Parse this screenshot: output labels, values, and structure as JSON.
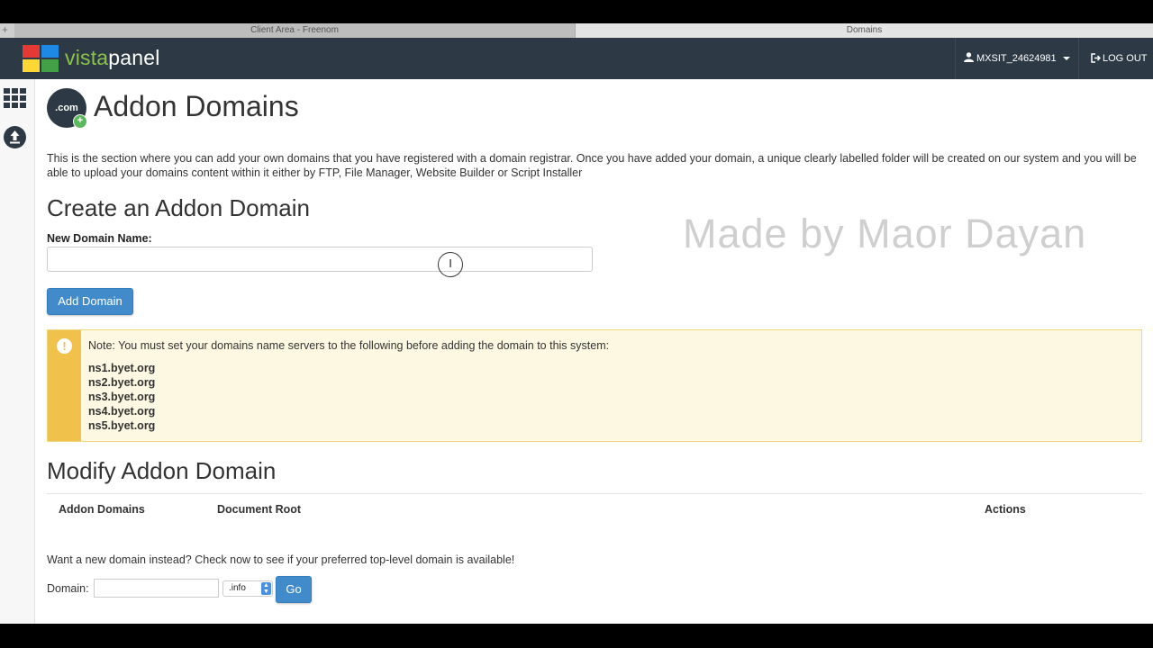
{
  "browser": {
    "tabs": [
      "Client Area - Freenom",
      "Domains"
    ],
    "new_tab_symbol": "+"
  },
  "topnav": {
    "logo_text_a": "vista",
    "logo_text_b": "panel",
    "user": "MXSIT_24624981",
    "logout": "LOG OUT",
    "icons": [
      "apps-grid-icon",
      "upload-icon",
      "user-icon",
      "logout-icon"
    ]
  },
  "page": {
    "icon_text": ".com",
    "title": "Addon Domains",
    "intro": "This is the section where you can add your own domains that you have registered with a domain registrar. Once you have added your domain, a unique clearly labelled folder will be created on our system and you will be able to upload your domains content within it either by FTP, File Manager, Website Builder or Script Installer",
    "create_heading": "Create an Addon Domain",
    "new_domain_label": "New Domain Name:",
    "new_domain_value": "",
    "add_button": "Add Domain",
    "watermark": "Made by Maor Dayan"
  },
  "alert": {
    "icon": "!",
    "note": "Note: You must set your domains name servers to the following before adding the domain to this system:",
    "nameservers": [
      "ns1.byet.org",
      "ns2.byet.org",
      "ns3.byet.org",
      "ns4.byet.org",
      "ns5.byet.org"
    ]
  },
  "modify": {
    "heading": "Modify Addon Domain",
    "columns": [
      "Addon Domains",
      "Document Root",
      "Actions"
    ]
  },
  "check": {
    "text": "Want a new domain instead? Check now to see if your preferred top-level domain is available!",
    "domain_label": "Domain:",
    "domain_value": "",
    "tld_selected": ".info",
    "go": "Go"
  },
  "colors": {
    "nav_bg": "#2d3a46",
    "primary": "#428bca",
    "alert_strip": "#f0c24b",
    "alert_bg": "#fdf8e2"
  }
}
